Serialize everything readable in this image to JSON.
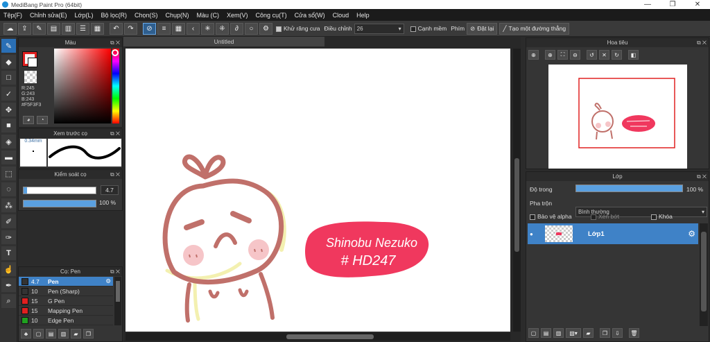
{
  "window": {
    "title": "MediBang Paint Pro (64bit)",
    "minimize": "—",
    "restore": "❐",
    "close": "✕"
  },
  "menu": [
    "Tệp(F)",
    "Chỉnh sửa(E)",
    "Lớp(L)",
    "Bộ lọc(R)",
    "Chọn(S)",
    "Chụp(N)",
    "Màu (C)",
    "Xem(V)",
    "Công cụ(T)",
    "Cửa sổ(W)",
    "Cloud",
    "Help"
  ],
  "toolbar": {
    "antialias_label": "Khử răng cưa",
    "adjust_label": "Điều chỉnh",
    "adjust_value": "26",
    "edge_label": "Cạnh mềm",
    "key_label": "Phím",
    "reset_label": "Đặt lại",
    "straight_line_label": "Tạo một đường thẳng"
  },
  "color_panel": {
    "title": "Màu",
    "r": "R:245",
    "g": "G:243",
    "b": "B:243",
    "hex": "#F5F3F3",
    "primary": "#e02020",
    "secondary": "#f5f3f3"
  },
  "brush_preview": {
    "title": "Xem trước cọ",
    "size": "0.34mm"
  },
  "brush_control": {
    "title": "Kiểm soát cọ",
    "size_value": "4.7",
    "opacity_value": "100 %",
    "opacity": 1.0,
    "size_fill": 0.05
  },
  "brush_list": {
    "title": "Cọ: Pen",
    "items": [
      {
        "size": "4.7",
        "name": "Pen",
        "color": "#333333"
      },
      {
        "size": "10",
        "name": "Pen (Sharp)",
        "color": "#333333"
      },
      {
        "size": "15",
        "name": "G Pen",
        "color": "#e02020"
      },
      {
        "size": "15",
        "name": "Mapping Pen",
        "color": "#e02020"
      },
      {
        "size": "10",
        "name": "Edge Pen",
        "color": "#20a020"
      }
    ]
  },
  "document": {
    "tab": "Untitled"
  },
  "artwork": {
    "caption_line1": "Shinobu Nezuko",
    "caption_line2": "# HD247",
    "outline_color": "#c0706a",
    "badge_color": "#f0385e"
  },
  "navigator": {
    "title": "Hoa tiêu"
  },
  "layers": {
    "title": "Lớp",
    "opacity_label": "Độ trong",
    "opacity_value": "100 %",
    "opacity": 1.0,
    "blend_label": "Pha trộn",
    "blend_value": "Bình thường",
    "protect_alpha": "Bảo vệ alpha",
    "clipping": "Xén bớt",
    "lock": "Khóa",
    "items": [
      {
        "name": "Lớp1"
      }
    ]
  }
}
